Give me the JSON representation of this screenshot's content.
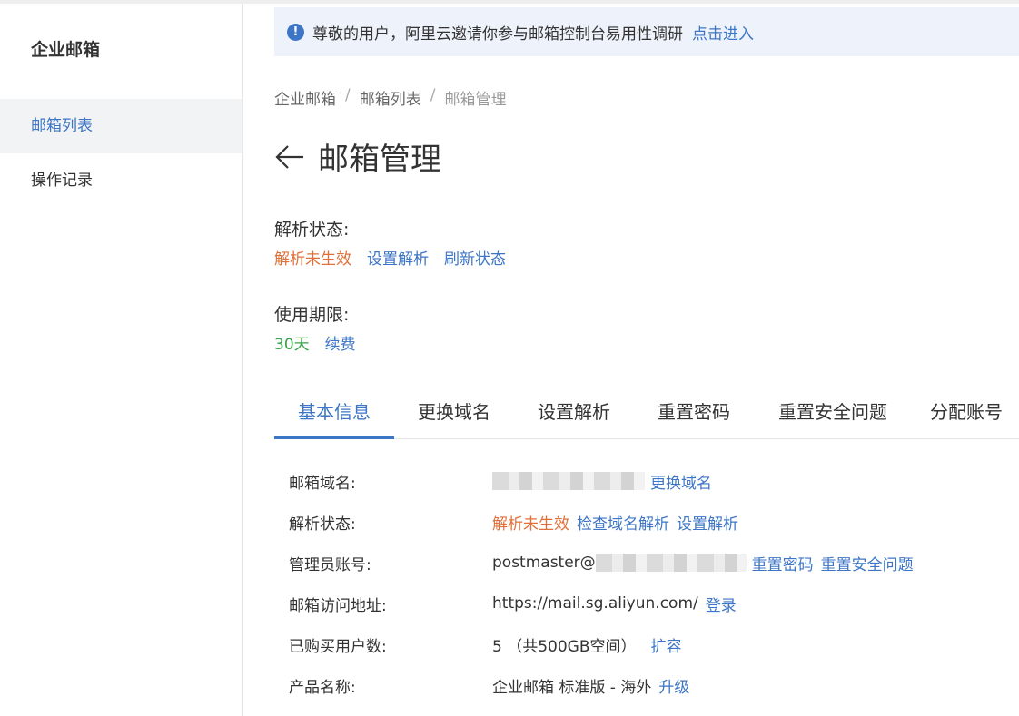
{
  "sidebar": {
    "title": "企业邮箱",
    "items": [
      {
        "label": "邮箱列表",
        "active": true
      },
      {
        "label": "操作记录",
        "active": false
      }
    ]
  },
  "notice": {
    "icon": "info-icon",
    "text": "尊敬的用户，阿里云邀请你参与邮箱控制台易用性调研",
    "link": "点击进入"
  },
  "breadcrumb": [
    "企业邮箱",
    "邮箱列表",
    "邮箱管理"
  ],
  "page": {
    "title": "邮箱管理",
    "back_icon": "arrow-left-icon"
  },
  "resolve": {
    "label": "解析状态:",
    "status": "解析未生效",
    "actions": [
      "设置解析",
      "刷新状态"
    ]
  },
  "period": {
    "label": "使用期限:",
    "value": "30天",
    "action": "续费"
  },
  "tabs": [
    "基本信息",
    "更换域名",
    "设置解析",
    "重置密码",
    "重置安全问题",
    "分配账号"
  ],
  "info": {
    "domain": {
      "label": "邮箱域名:",
      "action": "更换域名"
    },
    "resolve": {
      "label": "解析状态:",
      "status": "解析未生效",
      "check": "检查域名解析",
      "set": "设置解析"
    },
    "admin": {
      "label": "管理员账号:",
      "prefix": "postmaster@",
      "reset_pwd": "重置密码",
      "reset_q": "重置安全问题"
    },
    "url": {
      "label": "邮箱访问地址:",
      "value": "https://mail.sg.aliyun.com/",
      "action": "登录"
    },
    "users": {
      "label": "已购买用户数:",
      "value": "5 （共500GB空间）",
      "action": "扩容"
    },
    "product": {
      "label": "产品名称:",
      "value": "企业邮箱 标准版 - 海外",
      "action": "升级"
    }
  },
  "colors": {
    "accent": "#3d76c6",
    "warning": "#e0703a",
    "success": "#36a34a"
  }
}
